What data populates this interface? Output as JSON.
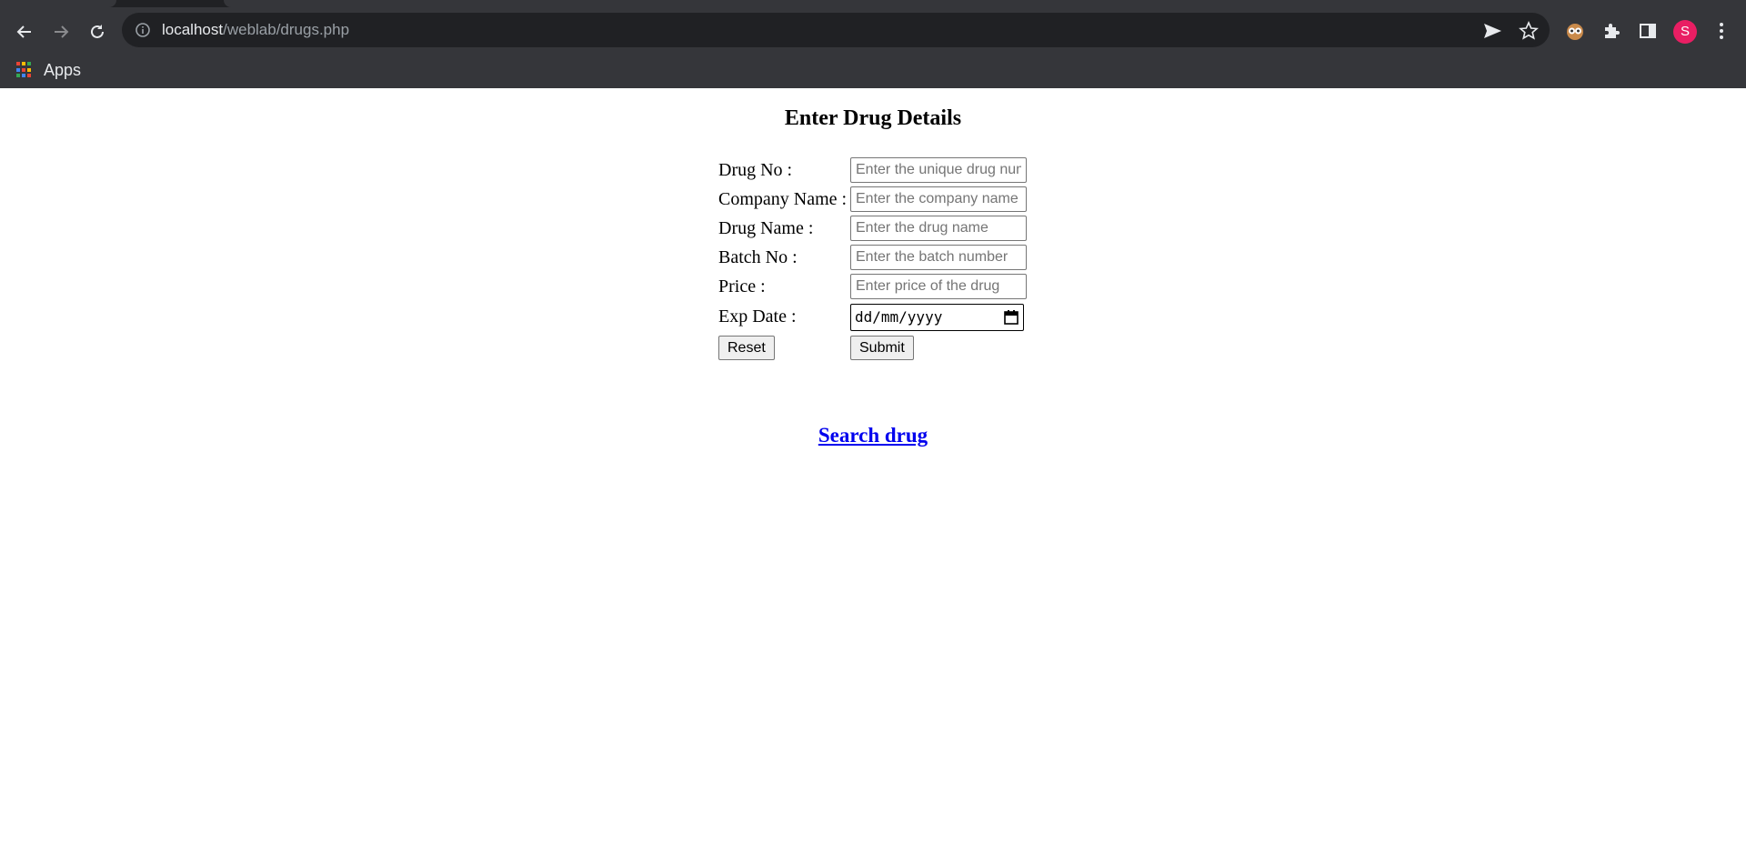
{
  "browser": {
    "url_host": "localhost",
    "url_path": "/weblab/drugs.php",
    "bookmarks": [
      {
        "label": "Apps",
        "icon": "apps-grid-icon"
      }
    ],
    "profile_initial": "S",
    "colors": {
      "frame": "#35363a",
      "omnibox": "#202124",
      "avatar": "#e91e63"
    }
  },
  "page": {
    "heading": "Enter Drug Details",
    "fields": [
      {
        "label": "Drug No :",
        "placeholder": "Enter the unique drug number",
        "value": ""
      },
      {
        "label": "Company Name :",
        "placeholder": "Enter the company name",
        "value": ""
      },
      {
        "label": "Drug Name :",
        "placeholder": "Enter the drug name",
        "value": ""
      },
      {
        "label": "Batch No :",
        "placeholder": "Enter the batch number",
        "value": ""
      },
      {
        "label": "Price :",
        "placeholder": "Enter price of the drug",
        "value": ""
      }
    ],
    "exp_date": {
      "label": "Exp Date :",
      "placeholder": "dd/mm/yyyy"
    },
    "reset_label": "Reset",
    "submit_label": "Submit",
    "search_link": "Search drug",
    "colors": {
      "link": "#0000ee"
    }
  }
}
